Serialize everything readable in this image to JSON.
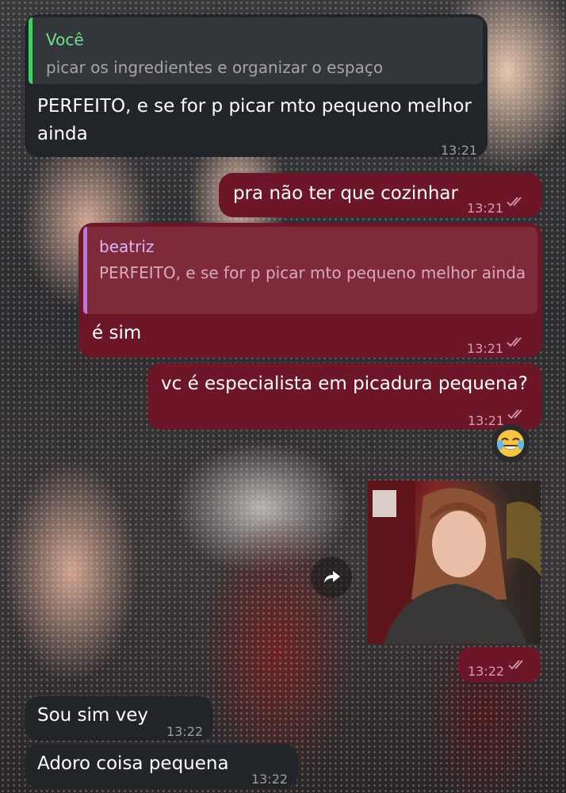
{
  "chat": {
    "messages": [
      {
        "direction": "incoming",
        "reply_to": {
          "author": "Você",
          "text": "picar os ingredientes e organizar o espaço"
        },
        "text": "PERFEITO, e se for p picar mto pequeno melhor ainda",
        "time": "13:21"
      },
      {
        "direction": "outgoing",
        "text": "pra não ter que cozinhar",
        "time": "13:21",
        "status": "read"
      },
      {
        "direction": "outgoing",
        "reply_to": {
          "author": "beatriz",
          "text": "PERFEITO, e se for p picar mto pequeno melhor ainda"
        },
        "text": "é sim",
        "time": "13:21",
        "status": "read"
      },
      {
        "direction": "outgoing",
        "text": "vc é especialista em picadura pequena?",
        "time": "13:21",
        "status": "read",
        "reaction": "😂"
      },
      {
        "direction": "outgoing",
        "type": "photo",
        "time": "13:22",
        "status": "read"
      },
      {
        "direction": "incoming",
        "text": "Sou sim vey",
        "time": "13:22"
      },
      {
        "direction": "incoming",
        "text": "Adoro coisa pequena",
        "time": "13:22"
      }
    ]
  },
  "colors": {
    "incoming_bubble": "#212529",
    "outgoing_bubble": "#6c1627",
    "reply_bar_incoming": "#3fcf68",
    "reply_bar_outgoing": "#b07ae8"
  },
  "icons": {
    "read_status": "double-check-icon",
    "forward": "share-arrow-icon",
    "reaction": "face-with-tears-of-joy"
  }
}
